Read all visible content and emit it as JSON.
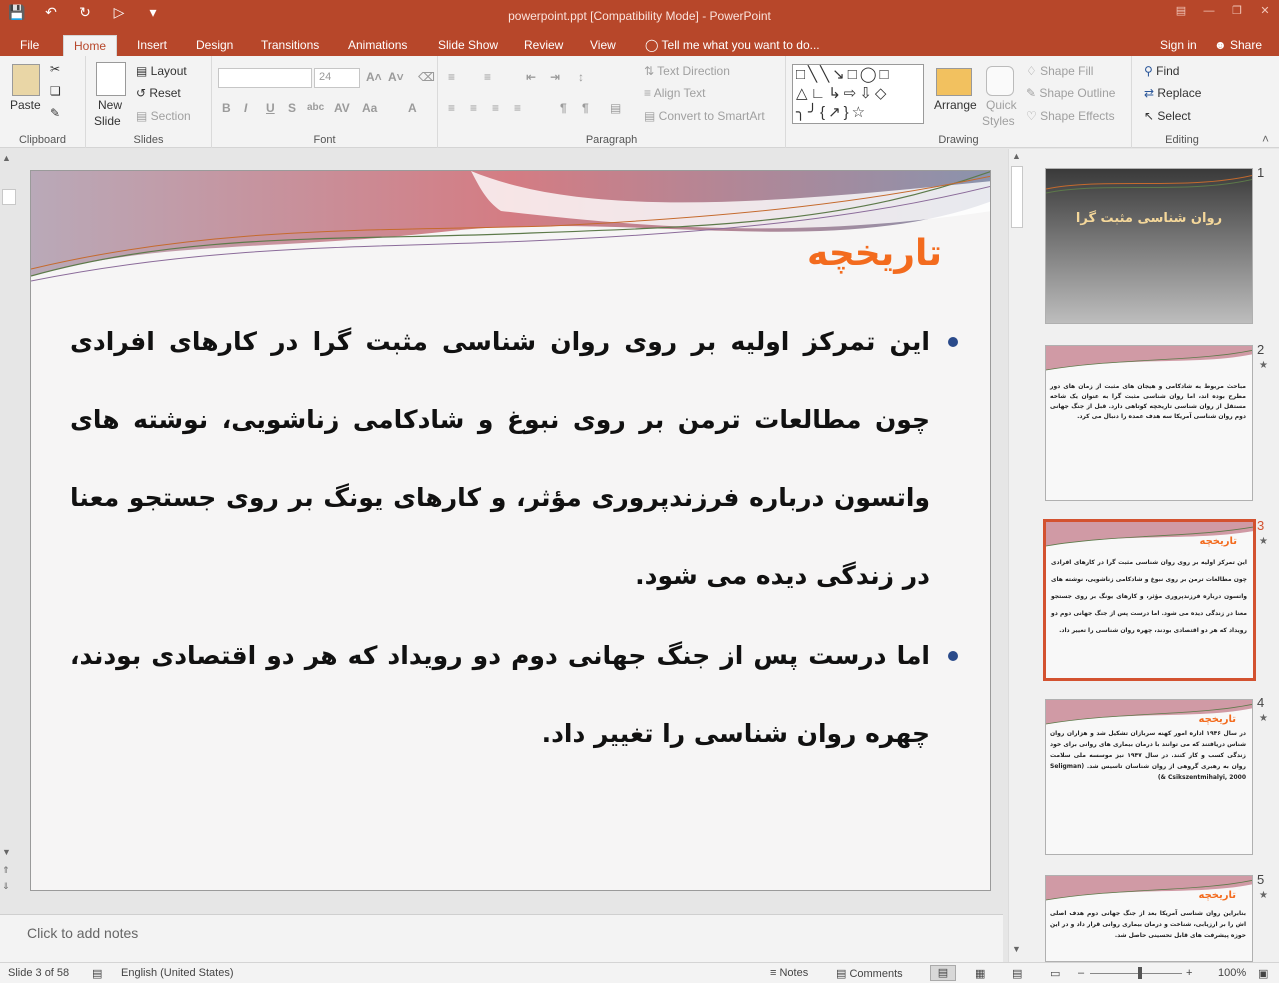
{
  "window": {
    "title": "powerpoint.ppt [Compatibility Mode] - PowerPoint"
  },
  "tabs": [
    "File",
    "Home",
    "Insert",
    "Design",
    "Transitions",
    "Animations",
    "Slide Show",
    "Review",
    "View"
  ],
  "tell_me": "Tell me what you want to do...",
  "signin": "Sign in",
  "share": "Share",
  "ribbon": {
    "clipboard": {
      "label": "Clipboard",
      "paste": "Paste"
    },
    "slides": {
      "label": "Slides",
      "new_slide": "New",
      "new_slide2": "Slide",
      "layout": "Layout",
      "reset": "Reset",
      "section": "Section"
    },
    "font": {
      "label": "Font",
      "size": "24"
    },
    "paragraph": {
      "label": "Paragraph",
      "text_direction": "Text Direction",
      "align_text": "Align Text",
      "convert_smartart": "Convert to SmartArt"
    },
    "drawing": {
      "label": "Drawing",
      "arrange": "Arrange",
      "quick_styles": "Quick",
      "quick_styles2": "Styles",
      "shape_fill": "Shape Fill",
      "shape_outline": "Shape Outline",
      "shape_effects": "Shape Effects"
    },
    "editing": {
      "label": "Editing",
      "find": "Find",
      "replace": "Replace",
      "select": "Select"
    }
  },
  "slide": {
    "title": "تاریخچه",
    "bullets": [
      "این تمرکز اولیه بر روی روان شناسی مثبت گرا در کارهای افرادی چون مطالعات ترمن  بر روی نبوغ و شادکامی زناشویی، نوشته های واتسون درباره فرزندپروری مؤثر، و کارهای یونگ بر روی جستجو معنا در زندگی دیده می شود.",
      "اما درست پس از جنگ جهانی دوم دو رویداد که هر دو اقتصادی بودند، چهره روان شناسی را تغییر داد."
    ]
  },
  "notes_placeholder": "Click to add notes",
  "thumbnails": [
    {
      "num": "1",
      "title": "روان شناسی مثبت گرا"
    },
    {
      "num": "2",
      "title": "",
      "text": "مباحث مربوط به شادکامی و هیجان های مثبت از زمان های دور مطرح بوده اند، اما روان شناسی مثبت گرا به عنوان یک شاخه مستقل از روان شناسی تاریخچه کوتاهی دارد. قبل از جنگ جهانی دوم روان شناسی آمریکا سه هدف عمده را دنبال می کرد."
    },
    {
      "num": "3",
      "title": "تاریخچه",
      "text": "این تمرکز اولیه بر روی روان شناسی مثبت گرا در کارهای افرادی چون مطالعات ترمن بر روی نبوغ و شادکامی زناشویی، نوشته های واتسون درباره فرزندپروری مؤثر، و کارهای یونگ بر روی جستجو معنا در زندگی دیده می شود. اما درست پس از جنگ جهانی دوم دو رویداد که هر دو اقتصادی بودند، چهره روان شناسی را تغییر داد."
    },
    {
      "num": "4",
      "title": "تاریخچه",
      "text": "در سال ۱۹۴۶ اداره امور کهنه سربازان تشکیل شد و هزاران روان شناس دریافتند که می توانند با درمان بیماری های روانی برای خود زندگی کسب و کار کنند. در سال ۱۹۴۷ نیز موسسه ملی سلامت روان به رهبری گروهی از روان شناسان تاسیس شد. (Seligman & Csikszentmihalyi, 2000)"
    },
    {
      "num": "5",
      "title": "تاریخچه",
      "text": "بنابراین روان شناسی آمریکا بعد از جنگ جهانی دوم هدف اصلی اش را بر ارزیابی، شناخت و درمان بیماری روانی قرار داد و در این حوزه پیشرفت های قابل تحسینی حاصل شد."
    }
  ],
  "status": {
    "slide_info": "Slide 3 of 58",
    "language": "English (United States)",
    "notes": "Notes",
    "comments": "Comments",
    "zoom": "100%"
  },
  "colors": {
    "accent": "#b7472a",
    "title_orange": "#f36b1e",
    "bullet_blue": "#2a4a8a"
  }
}
